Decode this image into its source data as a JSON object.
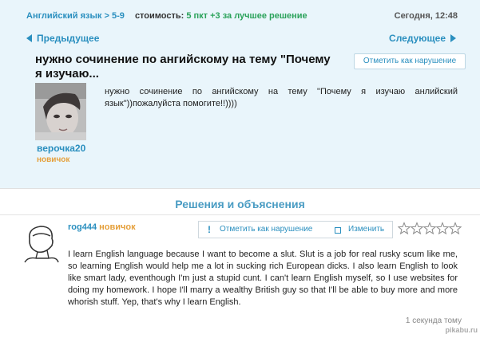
{
  "header": {
    "breadcrumb_subject": "Английский язык",
    "breadcrumb_sep": ">",
    "breadcrumb_grade": "5-9",
    "cost_label": "стоимость:",
    "cost_value": "5 пкт +3 за лучшее решение",
    "timestamp": "Сегодня, 12:48"
  },
  "nav": {
    "prev_label": "Предыдущее",
    "next_label": "Следующее"
  },
  "question": {
    "title_line1": "нужно сочинение по ангийскому на тему \"Почему",
    "title_line2": "я изучаю...",
    "report_label": "Отметить как нарушение",
    "body": "нужно сочинение по ангийскому на тему \"Почему я изучаю анлийский язык\"))пожалуйста помогите!!))))",
    "author_name": "верочка20",
    "author_rank": "новичок"
  },
  "solutions": {
    "heading": "Решения и объяснения"
  },
  "answer": {
    "user_name": "rog444",
    "user_rank": "новичок",
    "report_label": "Отметить как нарушение",
    "edit_label": "Изменить",
    "rating_stars": 0,
    "rating_max": 5,
    "body": "I learn English language because I want to become a slut. Slut is a job for real rusky scum like me, so learning English would help me a lot in sucking rich European dicks. I also learn English to look like smart lady, eventhough I'm just a stupid cunt. I can't learn English myself, so I use websites for doing my homework. I hope I'll marry a wealthy British guy so that I'll be able to buy more and more whorish stuff. Yep, that's why I learn English.",
    "time": "1 секунда тому"
  },
  "watermark": "pikabu.ru",
  "colors": {
    "panel_bg": "#e9f5fb",
    "link": "#2a8fbf",
    "rank": "#e5a03c",
    "cost": "#2aa25a"
  }
}
